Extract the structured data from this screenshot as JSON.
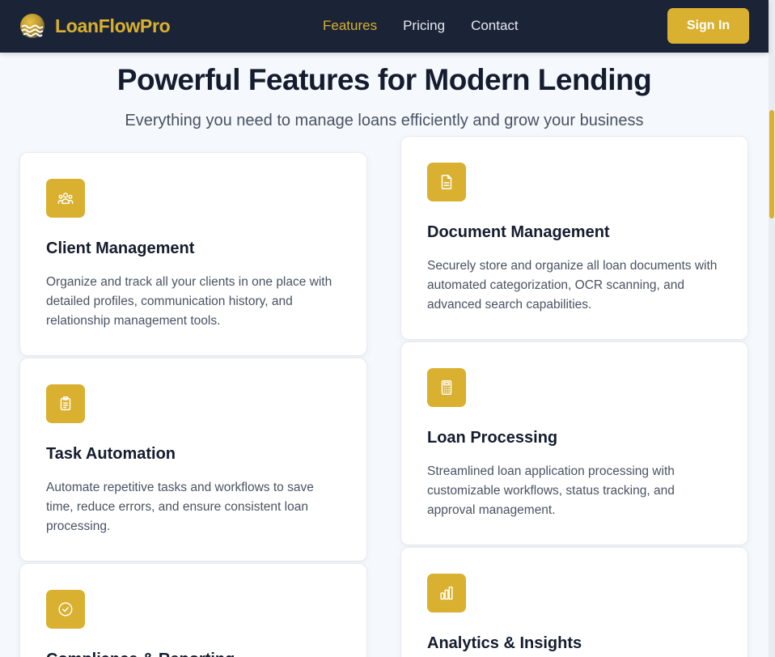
{
  "nav": {
    "brand": "LoanFlowPro",
    "links": [
      {
        "label": "Features",
        "active": true
      },
      {
        "label": "Pricing",
        "active": false
      },
      {
        "label": "Contact",
        "active": false
      }
    ],
    "signin_label": "Sign In"
  },
  "hero": {
    "title": "Powerful Features for Modern Lending",
    "subtitle": "Everything you need to manage loans efficiently and grow your business"
  },
  "features": [
    {
      "icon": "users-icon",
      "title": "Client Management",
      "desc": "Organize and track all your clients in one place with detailed profiles, communication history, and relationship management tools."
    },
    {
      "icon": "document-icon",
      "title": "Document Management",
      "desc": "Securely store and organize all loan documents with automated categorization, OCR scanning, and advanced search capabilities."
    },
    {
      "icon": "clipboard-icon",
      "title": "Task Automation",
      "desc": "Automate repetitive tasks and workflows to save time, reduce errors, and ensure consistent loan processing."
    },
    {
      "icon": "calculator-icon",
      "title": "Loan Processing",
      "desc": "Streamlined loan application processing with customizable workflows, status tracking, and approval management."
    },
    {
      "icon": "check-circle-icon",
      "title": "Compliance & Reporting",
      "desc": ""
    },
    {
      "icon": "bar-chart-icon",
      "title": "Analytics & Insights",
      "desc": ""
    }
  ],
  "colors": {
    "accent": "#d9b030",
    "navbar": "#1b2437",
    "background": "#f5f8fc",
    "heading": "#141c2e",
    "body_text": "#4a5262"
  }
}
